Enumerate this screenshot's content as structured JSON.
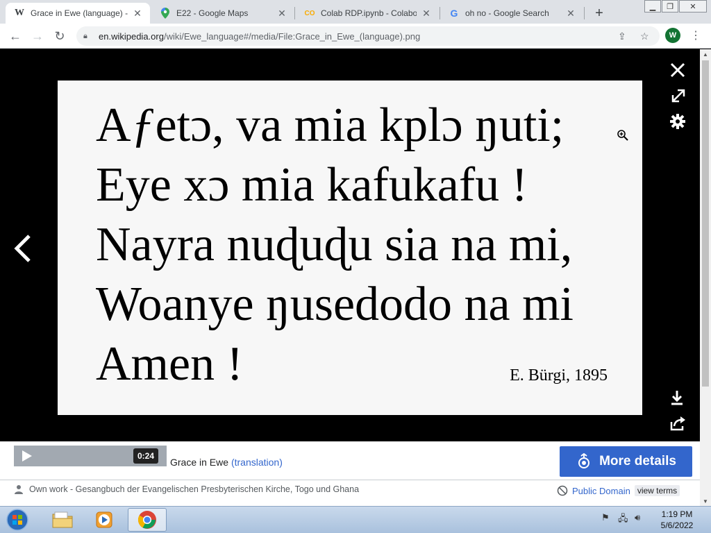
{
  "browser": {
    "tabs": [
      {
        "title": "Grace in Ewe (language) - E",
        "favicon": "W",
        "favicon_icon": "wikipedia-icon",
        "active": true
      },
      {
        "title": "E22 - Google Maps",
        "favicon_icon": "google-maps-icon",
        "active": false
      },
      {
        "title": "Colab RDP.ipynb - Colabor",
        "favicon": "CO",
        "favicon_icon": "colab-icon",
        "active": false
      },
      {
        "title": "oh no - Google Search",
        "favicon": "G",
        "favicon_icon": "google-icon",
        "active": false
      }
    ],
    "new_tab_label": "+",
    "url_domain": "en.wikipedia.org",
    "url_path": "/wiki/Ewe_language#/media/File:Grace_in_Ewe_(language).png",
    "profile_initial": "W"
  },
  "viewer": {
    "poem_lines": [
      "Afetɔ, va mia kplɔ ŋuti;",
      "Eye xɔ mia kafukafu !",
      "Nayra nuɖuɖu sia na mi,",
      "Woanye ŋusedodo na mi",
      "Amen !"
    ],
    "poem_first_word_prefix": "A",
    "poem_first_word_special": "ƒ",
    "poem_first_line_rest": "etɔ, va mia kplɔ ŋuti;",
    "attribution": "E. Bürgi, 1895"
  },
  "info": {
    "player_time": "0:24",
    "caption_text": "Grace in Ewe",
    "caption_link": "(translation)",
    "more_details_label": "More details",
    "author_text": "Own work - Gesangbuch der Evangelischen Presbyterischen Kirche, Togo und Ghana",
    "license_label": "Public Domain",
    "view_terms_label": "view terms"
  },
  "taskbar": {
    "time": "1:19 PM",
    "date": "5/6/2022"
  },
  "colors": {
    "accent_blue": "#3366cc",
    "viewer_bg": "#000000",
    "taskbar_top": "#c9d9ec"
  }
}
